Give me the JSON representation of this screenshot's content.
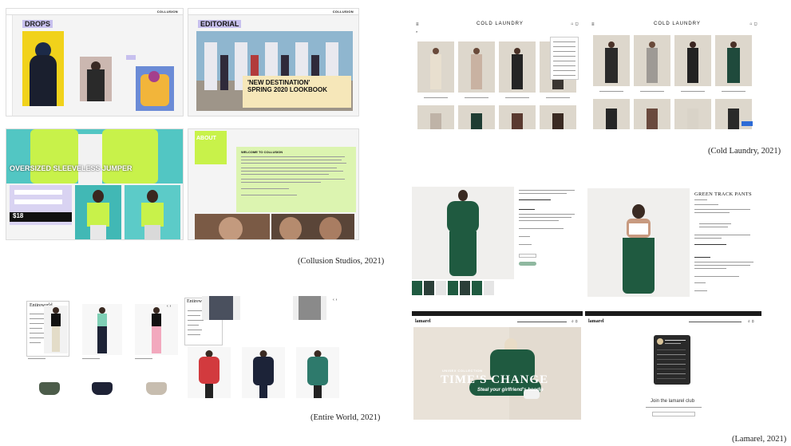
{
  "captions": {
    "collusion": "(Collusion Studios, 2021)",
    "cold_laundry": "(Cold Laundry, 2021)",
    "entire_world": "(Entire World, 2021)",
    "lamarel": "(Lamarel, 2021)"
  },
  "collusion": {
    "logo": "COLLUSION",
    "drops_title": "DROPS",
    "editorial_title": "EDITORIAL",
    "lookbook_title": "'NEW DESTINATION' SPRING 2020 LOOKBOOK",
    "jumper_title": "OVERSIZED SLEEVELESS JUMPER",
    "price": "$18",
    "about_title": "ABOUT",
    "about_heading": "WELCOME TO COLLUSION"
  },
  "cold_laundry": {
    "logo": "COLD LAUNDRY"
  },
  "entire_world": {
    "logo": "Entireworld"
  },
  "lamarel": {
    "product_title": "GREEN TRACK PANTS",
    "logo": "lamarel",
    "hero_line1": "UNISEX COLLECTION",
    "hero_line2": "TIME'S CHANGE",
    "hero_line3": "Steal your girlfriend's hoodie",
    "club_title": "Join the lamarel club"
  },
  "colors": {
    "lime": "#c8f24a",
    "lavender": "#d9d3f2",
    "forest": "#1f5a40",
    "sand": "#d8d2c6",
    "pale_green": "#dcf4b0"
  }
}
